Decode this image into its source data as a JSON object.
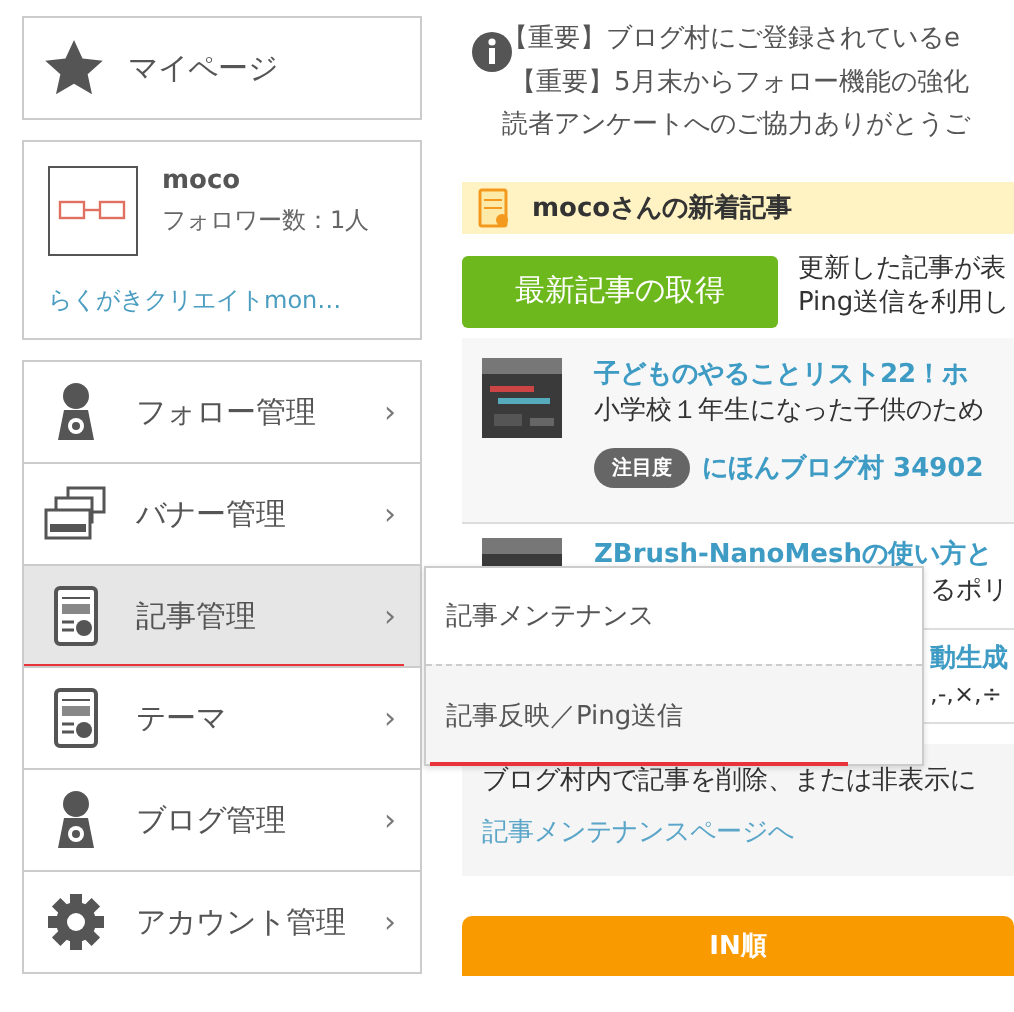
{
  "mypage": {
    "label": "マイページ"
  },
  "profile": {
    "name": "moco",
    "followers": "フォロワー数：1人",
    "blog_link": "らくがきクリエイトmon…"
  },
  "menu": [
    {
      "kind": "follow",
      "label": "フォロー管理",
      "arrow": "›",
      "selected": false
    },
    {
      "kind": "banner",
      "label": "バナー管理",
      "arrow": "›",
      "selected": false
    },
    {
      "kind": "post",
      "label": "記事管理",
      "arrow": "›",
      "selected": true,
      "submenu": [
        {
          "label": "記事メンテナンス",
          "selected": false
        },
        {
          "label": "記事反映／Ping送信",
          "selected": true
        }
      ]
    },
    {
      "kind": "theme",
      "label": "テーマ",
      "arrow": "›",
      "selected": false
    },
    {
      "kind": "blog",
      "label": "ブログ管理",
      "arrow": "›",
      "selected": false
    },
    {
      "kind": "account",
      "label": "アカウント管理",
      "arrow": "›",
      "selected": false
    }
  ],
  "notices": [
    "【重要】ブログ村にご登録されているe",
    "【重要】5月末からフォロー機能の強化",
    "読者アンケートへのご協力ありがとうご"
  ],
  "new_posts": {
    "title": "mocoさんの新着記事",
    "fetch_button": "最新記事の取得",
    "note": [
      "更新した記事が表",
      "Ping送信を利用し"
    ]
  },
  "articles": [
    {
      "title": "子どものやることリスト22！ホ",
      "description": "小学校１年生になった子供のため",
      "badge": "注目度",
      "rank": "にほんブログ村 34902"
    },
    {
      "title": "ZBrush-NanoMeshの使い方と",
      "description": "るポリ"
    },
    {
      "title": "動生成",
      "description": ",-,×,÷"
    }
  ],
  "maintenance": {
    "text": "ブログ村内で記事を削除、または非表示に",
    "link": "記事メンテナンスページへ"
  },
  "sort_button": "IN順"
}
